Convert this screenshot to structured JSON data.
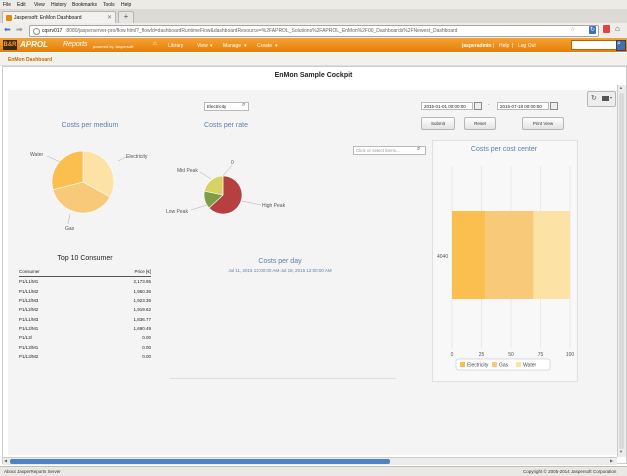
{
  "browser": {
    "menu": [
      "File",
      "Edit",
      "View",
      "History",
      "Bookmarks",
      "Tools",
      "Help"
    ],
    "tab_title": "Jaspersoft: EnMon Dashboard",
    "url_host": "cqsrv017",
    "url_rest": ":8080/jasperserver-pro/flow.html?_flowId=dashboardRuntimeFlow&dashboardResource=%2FAPROL_Solutions%2FAPROL_EnMon%2F00_Dashboards%2FNewest_Dashboard"
  },
  "app": {
    "logo_mark": "B&R",
    "brand": "APROL",
    "brand_sub": "Reports",
    "powered": "powered by Jaspersoft",
    "nav": [
      "Library",
      "View",
      "Manage",
      "Create"
    ],
    "user": "jasperadmin",
    "help": "Help",
    "logout": "Log Out"
  },
  "page": {
    "crumb": "EnMon Dashboard",
    "title": "EnMon Sample Cockpit"
  },
  "filters": {
    "medium": "Electricity",
    "date_from": "2015-01-01 00:00:00",
    "date_sep": "-",
    "date_to": "2015-07-18 00:00:00",
    "submit": "Submit",
    "reset": "Reset",
    "print": "Print View",
    "select_placeholder": "Click or select items..."
  },
  "medium_chart": {
    "title": "Costs per medium",
    "labels": [
      "Electricity",
      "Gas",
      "Water"
    ]
  },
  "rate_chart": {
    "title": "Costs per rate",
    "labels": [
      "0",
      "Mid Peak",
      "Low Peak",
      "High Peak"
    ]
  },
  "day_chart": {
    "title": "Costs per day",
    "subtitle": "Jul 11, 2015 12:00:00 AM-Jul 18, 2015 12:00:00 AM"
  },
  "top10": {
    "title": "Top 10 Consumer",
    "col_consumer": "Consumer",
    "col_price": "Price [€]",
    "rows": [
      {
        "consumer": "P1/L1/M1",
        "price": "2,173.95"
      },
      {
        "consumer": "P1/L1/M2",
        "price": "1,950.36"
      },
      {
        "consumer": "P1/L2/M3",
        "price": "1,923.36"
      },
      {
        "consumer": "P1/L2/M2",
        "price": "1,919.62"
      },
      {
        "consumer": "P1/L1/M3",
        "price": "1,836.77"
      },
      {
        "consumer": "P1/L2/M1",
        "price": "1,690.49"
      },
      {
        "consumer": "P1/L3/",
        "price": "0.00"
      },
      {
        "consumer": "P1/L3/M1",
        "price": "0.00"
      },
      {
        "consumer": "P1/L3/M2",
        "price": "0.00"
      }
    ]
  },
  "status": {
    "left": "About JasperReports Server",
    "right": "Copyright © 2005-2014 Jaspersoft Corporation"
  },
  "chart_data": [
    {
      "type": "pie",
      "title": "Costs per medium",
      "categories": [
        "Electricity",
        "Gas",
        "Water"
      ],
      "values": [
        33,
        38,
        29
      ],
      "colors": [
        "#fde2a6",
        "#f8c978",
        "#fbbf4f"
      ]
    },
    {
      "type": "pie",
      "title": "Costs per rate",
      "categories": [
        "High Peak",
        "Low Peak",
        "Mid Peak",
        "0"
      ],
      "values": [
        58,
        14,
        20,
        0
      ],
      "colors": [
        "#b5403f",
        "#7f9c46",
        "#d6d364",
        "#cccccc"
      ]
    },
    {
      "type": "bar",
      "orientation": "horizontal",
      "stacked": true,
      "title": "Costs per cost center",
      "categories": [
        "4040"
      ],
      "series": [
        {
          "name": "Electricity",
          "values": [
            28
          ],
          "color": "#fbbf4f"
        },
        {
          "name": "Gas",
          "values": [
            41
          ],
          "color": "#f8c978"
        },
        {
          "name": "Water",
          "values": [
            31
          ],
          "color": "#fde2a6"
        }
      ],
      "xlim": [
        0,
        100
      ],
      "xticks": [
        "0",
        "25",
        "50",
        "75",
        "100"
      ],
      "legend": "bottom"
    }
  ]
}
